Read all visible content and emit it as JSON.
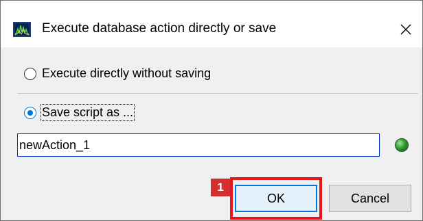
{
  "window": {
    "title": "Execute database action directly or save",
    "icon": "app-waveform-icon",
    "close_glyph": "✕"
  },
  "options": {
    "execute_directly_label": "Execute directly without saving",
    "execute_directly_selected": false,
    "save_script_label": "Save script as ...",
    "save_script_selected": true
  },
  "script_name": {
    "value": "newAction_1",
    "status_color": "#2f9e2f"
  },
  "annotation": {
    "step_number": "1",
    "highlight_color": "#e8131b"
  },
  "buttons": {
    "ok_label": "OK",
    "cancel_label": "Cancel"
  }
}
